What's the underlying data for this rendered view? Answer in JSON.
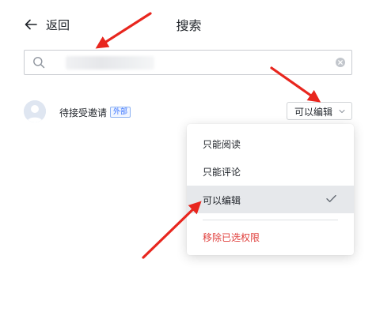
{
  "header": {
    "back_label": "返回",
    "title": "搜索"
  },
  "search": {
    "value": "",
    "placeholder": ""
  },
  "member": {
    "name": "待接受邀请",
    "tag": "外部"
  },
  "permission": {
    "selected": "可以编辑"
  },
  "dropdown": {
    "items": [
      {
        "label": "只能阅读",
        "selected": false
      },
      {
        "label": "只能评论",
        "selected": false
      },
      {
        "label": "可以编辑",
        "selected": true
      }
    ],
    "remove_label": "移除已选权限"
  },
  "colors": {
    "annotation_arrow": "#e8261e",
    "danger": "#e0403d",
    "tag_blue": "#3370ff",
    "selected_bg": "#e6e8eb"
  },
  "icons": [
    "back-arrow-icon",
    "search-icon",
    "clear-icon",
    "avatar-icon",
    "chevron-down-icon",
    "check-icon"
  ]
}
